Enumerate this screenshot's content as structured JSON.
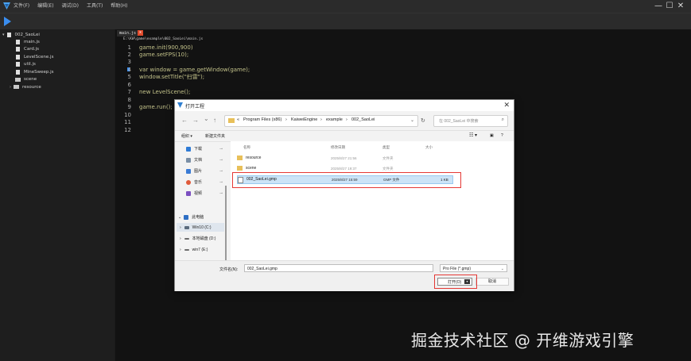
{
  "menu": [
    "文件(F)",
    "编辑(E)",
    "调试(D)",
    "工具(T)",
    "帮助(H)"
  ],
  "window_controls": {
    "minimize": "—",
    "maximize": "☐",
    "close": "✕"
  },
  "project_tree": {
    "root": "002_SaoLei",
    "files": [
      "main.js",
      "Card.js",
      "LevelScene.js",
      "util.js",
      "MineSweep.js"
    ],
    "folders": [
      "scene",
      "resource"
    ]
  },
  "editor": {
    "tab_label": "main.js",
    "tab_close": "x",
    "path": "E:\\KW\\game\\example\\002_SaoLei\\main.js",
    "lines": [
      {
        "n": "1",
        "text": "game.init(900,900)"
      },
      {
        "n": "2",
        "text": "game.setFPS(10);"
      },
      {
        "n": "3",
        "text": ""
      },
      {
        "n": "4",
        "text": "var window = game.getWindow(game);"
      },
      {
        "n": "5",
        "text": "window.setTitle(\"扫雷\");"
      },
      {
        "n": "6",
        "text": ""
      },
      {
        "n": "7",
        "text": "new LevelScene();"
      },
      {
        "n": "8",
        "text": ""
      },
      {
        "n": "9",
        "text": "game.run();"
      },
      {
        "n": "10",
        "text": ""
      },
      {
        "n": "11",
        "text": ""
      },
      {
        "n": "12",
        "text": ""
      }
    ]
  },
  "dialog": {
    "title": "打开工程",
    "close": "✕",
    "nav": {
      "back": "←",
      "forward": "→",
      "dropdown": "⌄",
      "up": "↑"
    },
    "address": [
      "«",
      "Program Files (x86)",
      "›",
      "KaiweiEngine",
      "›",
      "example",
      "›",
      "002_SaoLei"
    ],
    "search_placeholder": "在 002_SaoLei 中搜索",
    "commands": {
      "organize": "组织 ▾",
      "new_folder": "新建文件夹"
    },
    "quick_access": [
      {
        "label": "下载",
        "color": "#2e7bd6"
      },
      {
        "label": "文档",
        "color": "#7a8fa6"
      },
      {
        "label": "图片",
        "color": "#3a7bd5"
      },
      {
        "label": "音乐",
        "color": "#e05a3a"
      },
      {
        "label": "视频",
        "color": "#7b4fc0"
      }
    ],
    "pin": "📌",
    "this_pc": "此电脑",
    "drives": [
      "Win10 (C:)",
      "本地磁盘 (D:)",
      "win7 (E:)"
    ],
    "columns": {
      "name": "名称",
      "date": "修改日期",
      "type": "类型",
      "size": "大小"
    },
    "files": [
      {
        "name": "resource",
        "date": "2025/8/27 21:56",
        "type": "文件夹",
        "size": "",
        "kind": "folder"
      },
      {
        "name": "scene",
        "date": "2025/8/27 19:37",
        "type": "文件夹",
        "size": "",
        "kind": "folder"
      },
      {
        "name": "002_SaoLei.gmp",
        "date": "2025/8/27 15:59",
        "type": "GMP 文件",
        "size": "1 KB",
        "kind": "file"
      }
    ],
    "filename_label": "文件名(N):",
    "filename_value": "002_SaoLei.gmp",
    "filetype_value": "Pro File (*.gmp)",
    "open_label": "打开(O)",
    "cancel_label": "取消"
  },
  "watermark": "掘金技术社区 @ 开维游戏引擎",
  "colors": {
    "accent": "#3a8ef0",
    "highlight_box": "#e53935",
    "code_text": "#c3c28a",
    "selection": "#cce4f7"
  }
}
